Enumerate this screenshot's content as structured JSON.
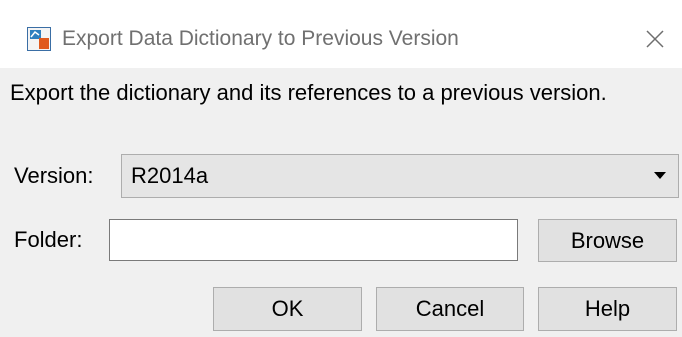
{
  "window": {
    "title": "Export Data Dictionary to Previous Version",
    "app_icon": "simulink-model-icon",
    "close_icon": "close-icon"
  },
  "dialog": {
    "description": "Export the dictionary and its references to a previous version.",
    "version_label": "Version:",
    "version_value": "R2014a",
    "folder_label": "Folder:",
    "folder_value": "",
    "browse_label": "Browse",
    "ok_label": "OK",
    "cancel_label": "Cancel",
    "help_label": "Help"
  },
  "colors": {
    "title_text": "#707070",
    "dialog_background": "#f0f0f0",
    "button_background": "#e1e1e1",
    "button_border": "#adadad",
    "icon_accent": "#e05a1e"
  }
}
